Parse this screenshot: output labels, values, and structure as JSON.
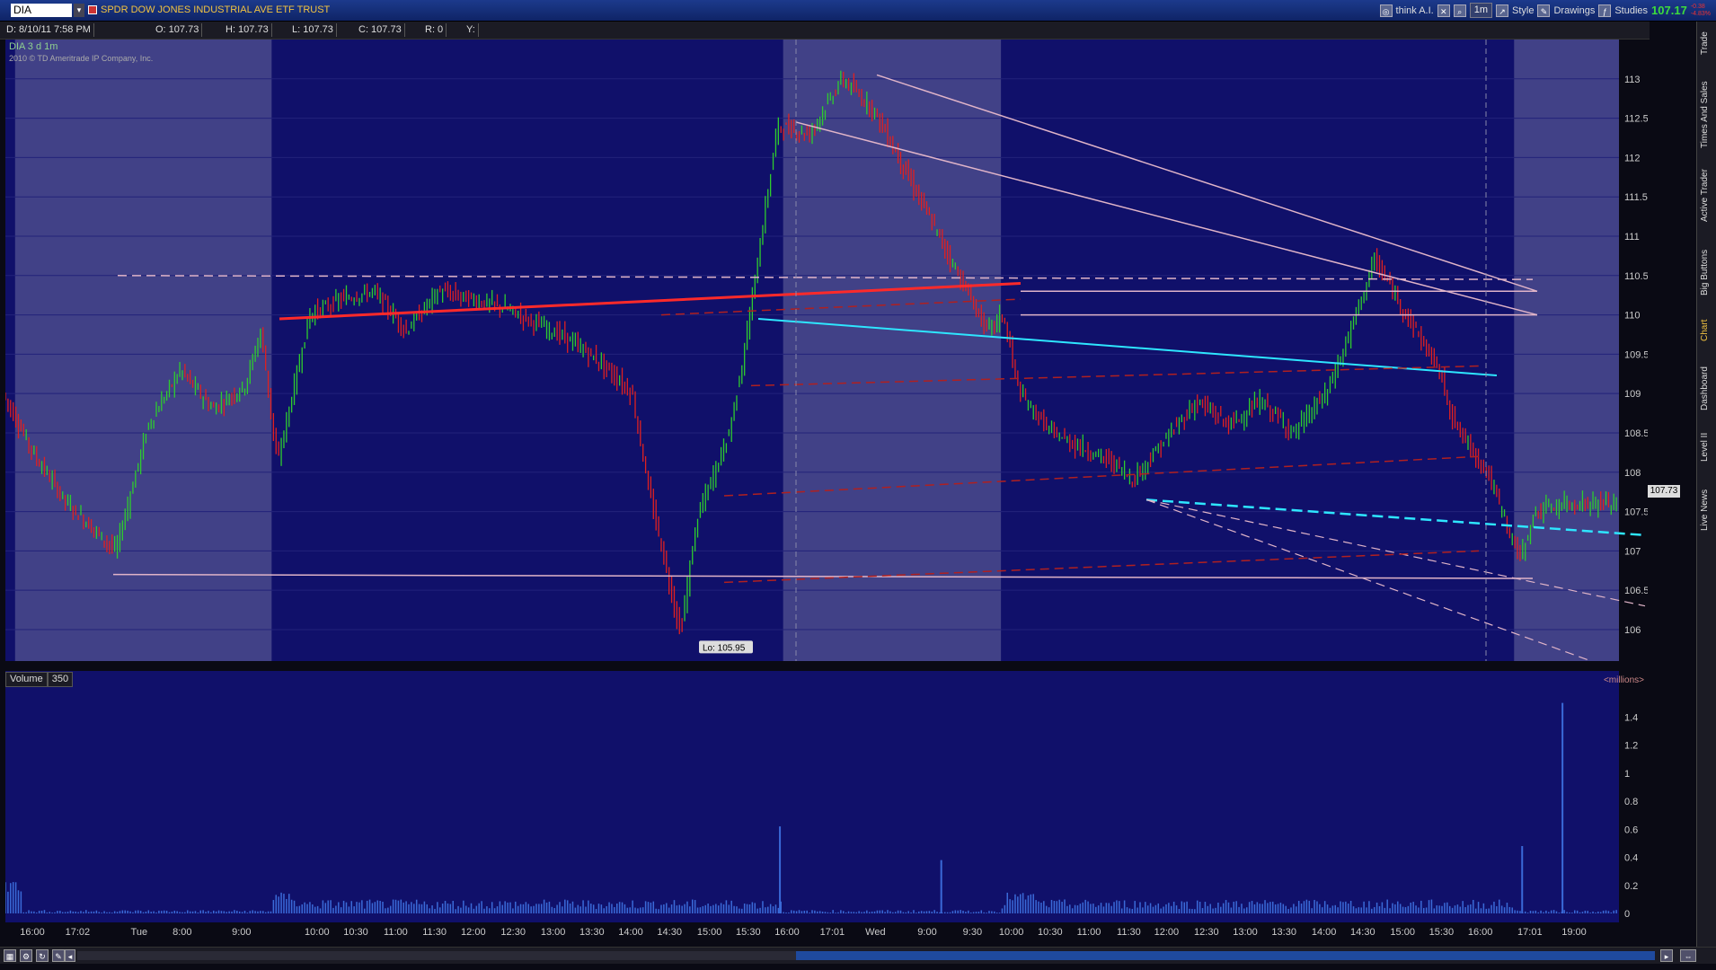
{
  "toolbar": {
    "symbol": "DIA",
    "description": "SPDR DOW JONES INDUSTRIAL AVE ETF TRUST",
    "think_label": "think A.I.",
    "interval_label": "1m",
    "style_label": "Style",
    "drawings_label": "Drawings",
    "studies_label": "Studies",
    "last_price": "107.17",
    "change_1": "-0.38",
    "change_2": "-4.83%"
  },
  "infobar": {
    "chart_label": "DIA 3 d 1m",
    "date": "D: 8/10/11 7:58 PM",
    "open": "O: 107.73",
    "high": "H: 107.73",
    "low": "L: 107.73",
    "close": "C: 107.73",
    "range": "R: 0",
    "y": "Y:"
  },
  "chart_header": {
    "copyright": "2010 © TD Ameritrade IP Company, Inc."
  },
  "volume_panel": {
    "title": "Volume",
    "value": "350",
    "unit": "<millions>"
  },
  "right_tabs": [
    "Trade",
    "Times And Sales",
    "Active Trader",
    "Big Buttons",
    "Chart",
    "Dashboard",
    "Level II",
    "Live News"
  ],
  "active_tab": "Chart",
  "chart_data": {
    "type": "candlestick",
    "title": "DIA 3 d 1m",
    "price_axis": {
      "ticks": [
        "113",
        "112.5",
        "112",
        "111.5",
        "111",
        "110.5",
        "110",
        "109.5",
        "109",
        "108.5",
        "108",
        "107.5",
        "107",
        "106.5",
        "106"
      ],
      "range": [
        105.6,
        113.5
      ]
    },
    "volume_axis": {
      "ticks": [
        "1.4",
        "1.2",
        "1",
        "0.8",
        "0.6",
        "0.4",
        "0.2",
        "0"
      ],
      "range": [
        0,
        1.6
      ],
      "unit": "millions"
    },
    "time_ticks": [
      "16:00",
      "17:02",
      "Tue",
      "8:00",
      "9:00",
      "10:00",
      "10:30",
      "11:00",
      "11:30",
      "12:00",
      "12:30",
      "13:00",
      "13:30",
      "14:00",
      "14:30",
      "15:00",
      "15:30",
      "16:00",
      "17:01",
      "Wed",
      "9:00",
      "9:30",
      "10:00",
      "10:30",
      "11:00",
      "11:30",
      "12:00",
      "12:30",
      "13:00",
      "13:30",
      "14:00",
      "14:30",
      "15:00",
      "15:30",
      "16:00",
      "17:01",
      "19:00"
    ],
    "current_price_label": "107.73",
    "low_label": "Lo: 105.95",
    "low_value": 105.95,
    "price_path": [
      [
        0,
        109.0
      ],
      [
        0.02,
        108.2
      ],
      [
        0.04,
        107.6
      ],
      [
        0.06,
        107.2
      ],
      [
        0.07,
        107.0
      ],
      [
        0.09,
        108.6
      ],
      [
        0.11,
        109.3
      ],
      [
        0.13,
        108.8
      ],
      [
        0.15,
        109.1
      ],
      [
        0.16,
        109.8
      ],
      [
        0.17,
        108.1
      ],
      [
        0.19,
        110.0
      ],
      [
        0.21,
        110.2
      ],
      [
        0.23,
        110.3
      ],
      [
        0.25,
        109.8
      ],
      [
        0.27,
        110.3
      ],
      [
        0.29,
        110.2
      ],
      [
        0.31,
        110.1
      ],
      [
        0.33,
        109.9
      ],
      [
        0.35,
        109.7
      ],
      [
        0.37,
        109.4
      ],
      [
        0.39,
        109.0
      ],
      [
        0.4,
        107.8
      ],
      [
        0.42,
        105.95
      ],
      [
        0.43,
        107.4
      ],
      [
        0.45,
        108.5
      ],
      [
        0.46,
        109.6
      ],
      [
        0.47,
        111.0
      ],
      [
        0.48,
        112.4
      ],
      [
        0.5,
        112.3
      ],
      [
        0.52,
        113.0
      ],
      [
        0.54,
        112.6
      ],
      [
        0.56,
        111.8
      ],
      [
        0.58,
        111.0
      ],
      [
        0.6,
        110.2
      ],
      [
        0.61,
        109.8
      ],
      [
        0.62,
        110.0
      ],
      [
        0.63,
        109.0
      ],
      [
        0.65,
        108.5
      ],
      [
        0.67,
        108.3
      ],
      [
        0.69,
        108.1
      ],
      [
        0.7,
        107.9
      ],
      [
        0.72,
        108.4
      ],
      [
        0.74,
        108.9
      ],
      [
        0.76,
        108.6
      ],
      [
        0.78,
        108.9
      ],
      [
        0.8,
        108.5
      ],
      [
        0.82,
        109.0
      ],
      [
        0.83,
        109.5
      ],
      [
        0.85,
        110.7
      ],
      [
        0.87,
        110.0
      ],
      [
        0.89,
        109.3
      ],
      [
        0.9,
        108.6
      ],
      [
        0.92,
        108.0
      ],
      [
        0.94,
        106.9
      ],
      [
        0.95,
        107.5
      ],
      [
        0.97,
        107.6
      ],
      [
        1.0,
        107.6
      ]
    ],
    "volume_spikes": [
      [
        0.48,
        0.62
      ],
      [
        0.58,
        0.38
      ],
      [
        0.94,
        0.48
      ],
      [
        0.965,
        1.5
      ]
    ]
  }
}
